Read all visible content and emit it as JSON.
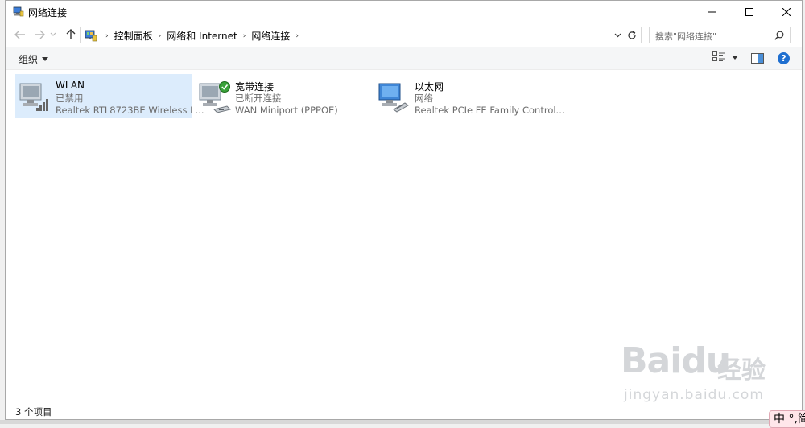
{
  "window": {
    "title": "网络连接"
  },
  "address": {
    "crumbs": [
      "控制面板",
      "网络和 Internet",
      "网络连接"
    ],
    "separator": "›"
  },
  "search": {
    "placeholder": "搜索\"网络连接\""
  },
  "toolbar": {
    "organize_label": "组织",
    "help_label": "?"
  },
  "connections": [
    {
      "name": "WLAN",
      "status": "已禁用",
      "device": "Realtek RTL8723BE Wireless L...",
      "icon": "wlan-adapter-icon",
      "selected": true
    },
    {
      "name": "宽带连接",
      "status": "已断开连接",
      "device": "WAN Miniport (PPPOE)",
      "icon": "broadband-adapter-icon",
      "selected": false
    },
    {
      "name": "以太网",
      "status": "网络",
      "device": "Realtek PCIe FE Family Control...",
      "icon": "ethernet-adapter-icon",
      "selected": false
    }
  ],
  "statusbar": {
    "item_count": "3 个项目"
  },
  "watermark": {
    "logo": "Baidu",
    "label": "经验",
    "url": "jingyan.baidu.com"
  },
  "ime": {
    "text": "中 °,简"
  },
  "colors": {
    "selection": "#dcecfc",
    "help_blue": "#1f6fd0",
    "secondary_text": "#6d6d6d"
  }
}
